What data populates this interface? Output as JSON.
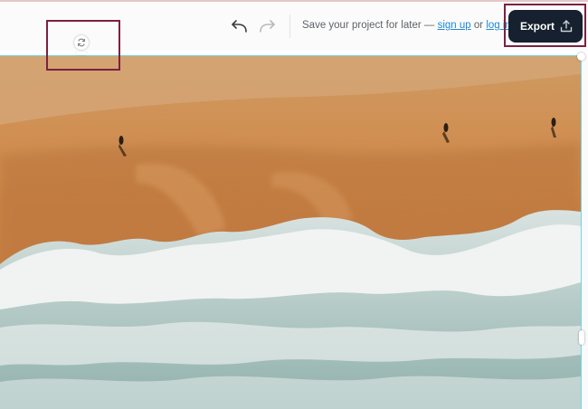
{
  "toolbar": {
    "undo_icon": "undo-arrow-icon",
    "redo_icon": "redo-arrow-icon",
    "save_prompt": "Save your project for later —",
    "sign_up_link": "sign up",
    "or_text": "or",
    "log_in_link": "log in",
    "export_label": "Export",
    "export_icon": "upload-icon"
  },
  "canvas": {
    "rotate_icon": "rotate-icon",
    "image_description_icon": "beach-aerial-image"
  },
  "colors": {
    "export_bg": "#16202e",
    "link": "#1e88d8",
    "highlight": "#7b2142",
    "selection": "#6fd6e8"
  }
}
